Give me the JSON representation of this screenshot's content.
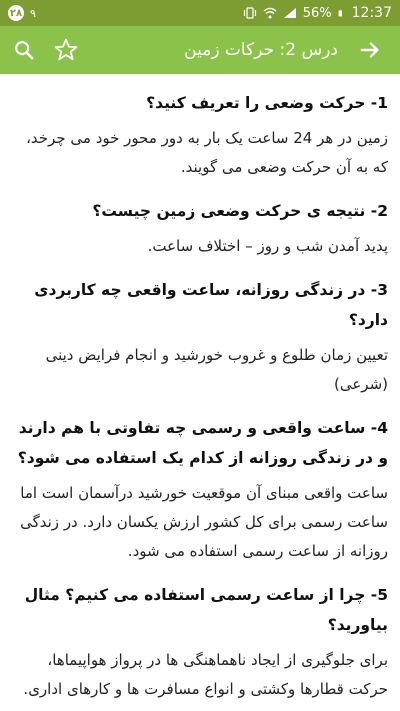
{
  "status_bar": {
    "time": "12:37",
    "battery": "56%",
    "notification_count": "۲۸",
    "notification_text": "۹"
  },
  "app_bar": {
    "title": "درس 2: حرکات زمین",
    "back_icon": "arrow-right-icon",
    "star_icon": "star-outline-icon",
    "search_icon": "search-icon"
  },
  "qa_items": [
    {
      "question": "1- حرکت وضعی را تعریف کنید؟",
      "answer": "زمین در هر 24 ساعت یک بار به دور محور خود می چرخد، که به آن حرکت وضعی می گویند."
    },
    {
      "question": "2- نتیجه ی حرکت وضعی زمین چیست؟",
      "answer": "پدید آمدن شب و روز – اختلاف ساعت."
    },
    {
      "question": "3- در زندگی روزانه، ساعت واقعی چه کاربردی دارد؟",
      "answer": "تعیین زمان طلوع و غروب خورشید و انجام فرایض دینی (شرعی)"
    },
    {
      "question": "4- ساعت واقعی و رسمی چه تفاوتی با هم دارند و در زندگی روزانه از کدام یک استفاده می شود؟",
      "answer": "ساعت واقعی مبنای آن موقعیت خورشید درآسمان است اما ساعت رسمی برای کل کشور ارزش یکسان دارد. در زندگی روزانه از ساعت رسمی استفاده می شود."
    },
    {
      "question": "5- چرا از ساعت رسمی استفاده می کنیم؟ مثال بیاورید؟",
      "answer": "برای جلوگیری از ایجاد ناهماهنگی ها در پرواز هواپیماها، حرکت قطارها وکشتی و انواع مسافرت ها و کارهای اداری."
    }
  ]
}
